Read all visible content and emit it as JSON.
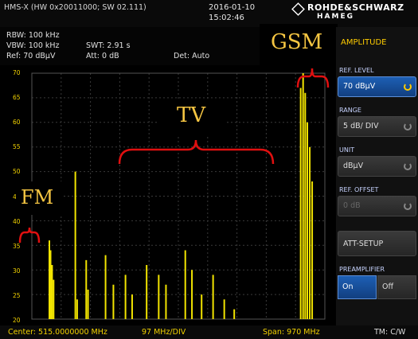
{
  "header": {
    "device_id": "HMS-X (HW 0x20011000; SW 02.111)",
    "date": "2016-01-10",
    "time": "15:02:46",
    "brand_name": "ROHDE&SCHWARZ",
    "brand_sub": "HAMEG"
  },
  "params": {
    "rbw": "RBW: 100 kHz",
    "vbw": "VBW: 100 kHz",
    "swt": "SWT: 2.91 s",
    "ref": "Ref: 70 dBµV",
    "att": "Att: 0 dB",
    "det": "Det: Auto"
  },
  "annotations": {
    "gsm": "GSM",
    "tv": "TV",
    "fm": "FM"
  },
  "status": {
    "center": "Center: 515.0000000 MHz",
    "div": "97 MHz/DIV",
    "span": "Span: 970 MHz",
    "tm": "TM: C/W"
  },
  "softkeys": {
    "title": "AMPLITUDE",
    "ref_level_label": "REF. LEVEL",
    "ref_level_value": "70 dBµV",
    "range_label": "RANGE",
    "range_value": "5 dB/ DIV",
    "unit_label": "UNIT",
    "unit_value": "dBµV",
    "ref_offset_label": "REF. OFFSET",
    "ref_offset_value": "0 dB",
    "att_setup": "ATT-SETUP",
    "preamp_label": "PREAMPLIFIER",
    "preamp_on": "On",
    "preamp_off": "Off"
  },
  "y_ticks": [
    "70",
    "65",
    "60",
    "55",
    "50",
    "45",
    "40",
    "35",
    "30",
    "25",
    "20"
  ],
  "colors": {
    "trace": "#f2e400",
    "grid": "#3a3a3a",
    "annotation_bracket": "#e01010",
    "accent_blue": "#1d5fb4"
  },
  "chart_data": {
    "type": "line",
    "x_start_mhz": 30,
    "x_end_mhz": 1000,
    "y_range_dbuv": [
      20,
      70
    ],
    "grid": true,
    "peaks": [
      {
        "f": 88,
        "level": 36
      },
      {
        "f": 92,
        "level": 34
      },
      {
        "f": 97,
        "level": 31
      },
      {
        "f": 102,
        "level": 28
      },
      {
        "f": 174,
        "level": 50
      },
      {
        "f": 180,
        "level": 24
      },
      {
        "f": 210,
        "level": 32
      },
      {
        "f": 216,
        "level": 26
      },
      {
        "f": 274,
        "level": 33
      },
      {
        "f": 300,
        "level": 27
      },
      {
        "f": 340,
        "level": 29
      },
      {
        "f": 362,
        "level": 25
      },
      {
        "f": 410,
        "level": 31
      },
      {
        "f": 450,
        "level": 29
      },
      {
        "f": 474,
        "level": 27
      },
      {
        "f": 538,
        "level": 34
      },
      {
        "f": 560,
        "level": 30
      },
      {
        "f": 592,
        "level": 25
      },
      {
        "f": 630,
        "level": 29
      },
      {
        "f": 667,
        "level": 24
      },
      {
        "f": 700,
        "level": 22
      },
      {
        "f": 920,
        "level": 67
      },
      {
        "f": 928,
        "level": 70
      },
      {
        "f": 935,
        "level": 66
      },
      {
        "f": 942,
        "level": 60
      },
      {
        "f": 950,
        "level": 55
      },
      {
        "f": 958,
        "level": 48
      }
    ]
  }
}
